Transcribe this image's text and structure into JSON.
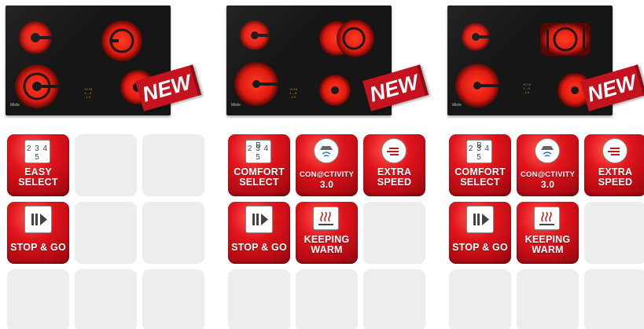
{
  "products": [
    {
      "id": "p1",
      "brand": "Miele",
      "controls": [
        "+0 +0",
        "1 -- 0",
        "- 1 0"
      ],
      "badge": "NEW",
      "tiles": [
        {
          "kind": "feature",
          "icon": "number-select-icon",
          "digits": "2 3 4 5",
          "letter": "",
          "lines": [
            "EASY",
            "SELECT"
          ]
        },
        {
          "kind": "empty"
        },
        {
          "kind": "empty"
        },
        {
          "kind": "feature",
          "icon": "pause-play-icon",
          "lines": [
            "STOP & GO"
          ]
        },
        {
          "kind": "empty"
        },
        {
          "kind": "empty"
        },
        {
          "kind": "empty"
        },
        {
          "kind": "empty"
        },
        {
          "kind": "empty"
        }
      ]
    },
    {
      "id": "p2",
      "brand": "Miele",
      "controls": [
        "+0 +0",
        "1 -- 0",
        "- 1 0"
      ],
      "badge": "NEW",
      "tiles": [
        {
          "kind": "feature",
          "icon": "number-select-icon",
          "digits": "2 3 4 5",
          "letter": "B",
          "lines": [
            "COMFORT",
            "SELECT"
          ]
        },
        {
          "kind": "feature",
          "icon": "hood-wifi-icon",
          "lines": [
            "CON@CTIVITY",
            "3.0"
          ]
        },
        {
          "kind": "feature",
          "icon": "speed-icon",
          "lines": [
            "EXTRA",
            "SPEED"
          ]
        },
        {
          "kind": "feature",
          "icon": "pause-play-icon",
          "lines": [
            "STOP & GO"
          ]
        },
        {
          "kind": "feature",
          "icon": "keep-warm-icon",
          "lines": [
            "KEEPING",
            "WARM"
          ]
        },
        {
          "kind": "empty"
        },
        {
          "kind": "empty"
        },
        {
          "kind": "empty"
        },
        {
          "kind": "empty"
        }
      ]
    },
    {
      "id": "p3",
      "brand": "Miele",
      "controls": [
        "+0 +0",
        "1 -- 0",
        "- 1 0"
      ],
      "badge": "NEW",
      "tiles": [
        {
          "kind": "feature",
          "icon": "number-select-icon",
          "digits": "2 3 4 5",
          "letter": "B",
          "lines": [
            "COMFORT",
            "SELECT"
          ]
        },
        {
          "kind": "feature",
          "icon": "hood-wifi-icon",
          "lines": [
            "CON@CTIVITY",
            "3.0"
          ]
        },
        {
          "kind": "feature",
          "icon": "speed-icon",
          "lines": [
            "EXTRA",
            "SPEED"
          ]
        },
        {
          "kind": "feature",
          "icon": "pause-play-icon",
          "lines": [
            "STOP & GO"
          ]
        },
        {
          "kind": "feature",
          "icon": "keep-warm-icon",
          "lines": [
            "KEEPING",
            "WARM"
          ]
        },
        {
          "kind": "empty"
        },
        {
          "kind": "empty"
        },
        {
          "kind": "empty"
        },
        {
          "kind": "empty"
        }
      ]
    }
  ]
}
